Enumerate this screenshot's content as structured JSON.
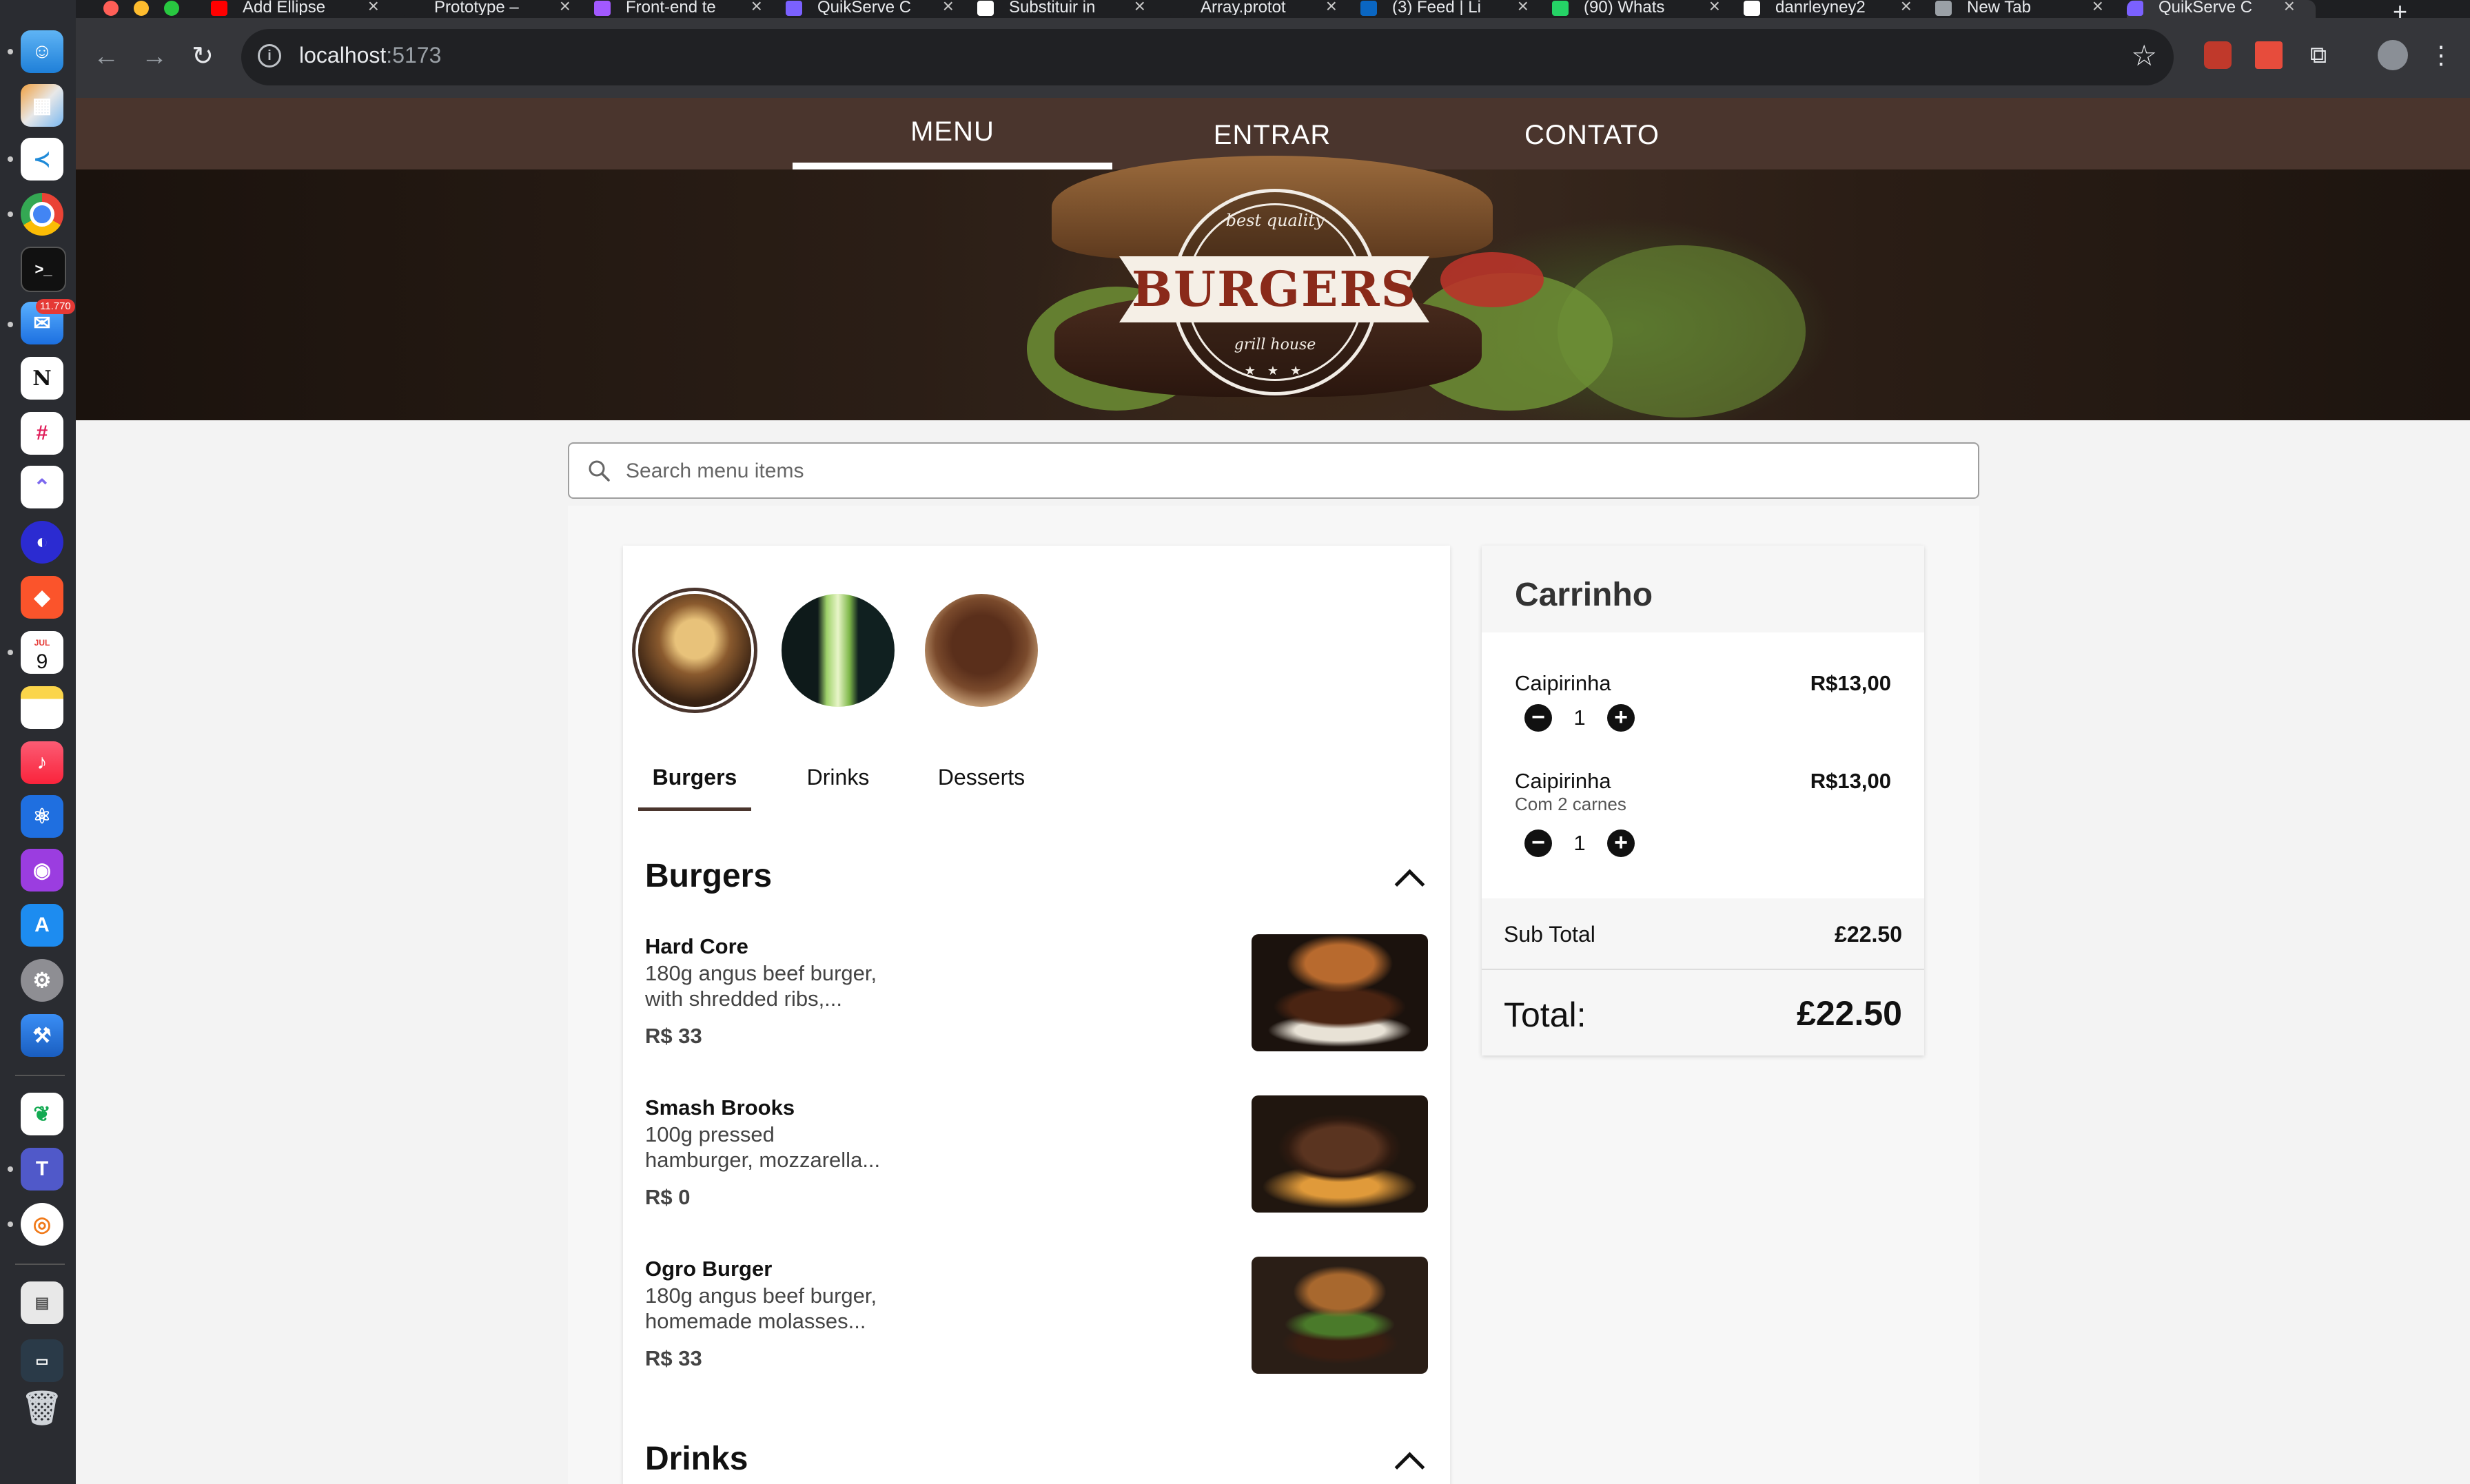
{
  "browser": {
    "tabs": [
      {
        "title": "Add Ellipse",
        "favicon_color": "#ff0000"
      },
      {
        "title": "Prototype –",
        "favicon_color": "#1e1f22"
      },
      {
        "title": "Front-end te",
        "favicon_color": "#a259ff"
      },
      {
        "title": "QuikServe C",
        "favicon_color": "#7b61ff"
      },
      {
        "title": "Substituir in",
        "favicon_color": "#ffffff"
      },
      {
        "title": "Array.protot",
        "favicon_color": "#1e1f22"
      },
      {
        "title": "(3) Feed | Li",
        "favicon_color": "#0a66c2"
      },
      {
        "title": "(90) Whats",
        "favicon_color": "#25d366"
      },
      {
        "title": "danrleyney2",
        "favicon_color": "#ffffff"
      },
      {
        "title": "New Tab",
        "favicon_color": "#9aa0a6"
      },
      {
        "title": "QuikServe C",
        "favicon_color": "#7b61ff",
        "active": true
      }
    ],
    "url_host": "localhost",
    "url_port": ":5173"
  },
  "dock": {
    "mail_badge": "11.770",
    "calendar_month": "JUL",
    "calendar_day": "9"
  },
  "nav": {
    "items": [
      {
        "label": "MENU",
        "active": true
      },
      {
        "label": "ENTRAR"
      },
      {
        "label": "CONTATO"
      }
    ]
  },
  "hero": {
    "badge_top": "best quality",
    "badge_main": "BURGERS",
    "badge_bottom": "grill house",
    "badge_stars": "★ ★ ★"
  },
  "search": {
    "placeholder": "Search menu items"
  },
  "categories": [
    {
      "label": "Burgers",
      "active": true
    },
    {
      "label": "Drinks"
    },
    {
      "label": "Desserts"
    }
  ],
  "sections": [
    {
      "title": "Burgers",
      "items": [
        {
          "name": "Hard Core",
          "desc_line1": "180g angus beef burger,",
          "desc_line2": "with shredded ribs,...",
          "price": "R$ 33"
        },
        {
          "name": "Smash Brooks",
          "desc_line1": "100g pressed",
          "desc_line2": "hamburger, mozzarella...",
          "price": "R$ 0"
        },
        {
          "name": "Ogro Burger",
          "desc_line1": "180g angus beef burger,",
          "desc_line2": "homemade molasses...",
          "price": "R$ 33"
        }
      ]
    },
    {
      "title": "Drinks"
    }
  ],
  "cart": {
    "title": "Carrinho",
    "items": [
      {
        "name": "Caipirinha",
        "price": "R$13,00",
        "qty": "1",
        "minus": "−",
        "plus": "+"
      },
      {
        "name": "Caipirinha",
        "note": "Com 2 carnes",
        "price": "R$13,00",
        "qty": "1",
        "minus": "−",
        "plus": "+"
      }
    ],
    "subtotal_label": "Sub Total",
    "subtotal_value": "£22.50",
    "total_label": "Total:",
    "total_value": "£22.50"
  },
  "colors": {
    "nav_bg": "#4a352d",
    "accent": "#4a352d"
  }
}
